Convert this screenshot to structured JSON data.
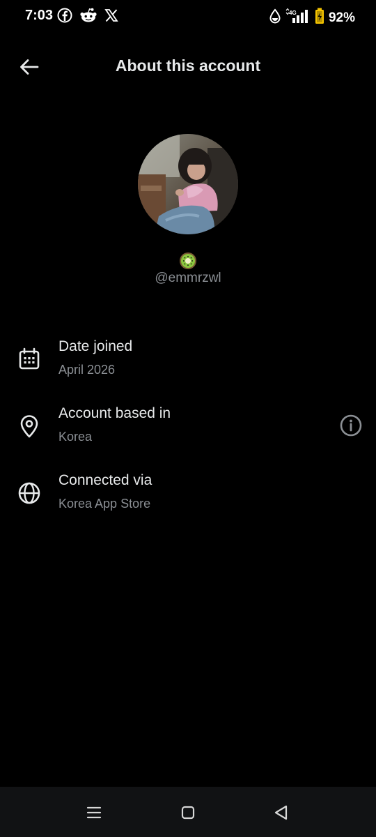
{
  "status_bar": {
    "time": "7:03",
    "network": "4G",
    "battery_percent": "92%",
    "left_icons": [
      "facebook-icon",
      "reddit-icon",
      "x-icon"
    ],
    "right_icons": [
      "data-saver-icon",
      "signal-icon",
      "battery-icon"
    ]
  },
  "header": {
    "title": "About this account",
    "back_icon": "arrow-left-icon"
  },
  "profile": {
    "emoji": "🥝",
    "handle": "@emmrzwl"
  },
  "info": [
    {
      "label": "Date joined",
      "value": "April 2026",
      "icon": "calendar-icon"
    },
    {
      "label": "Account based in",
      "value": "Korea",
      "icon": "location-pin-icon",
      "action_icon": "info-icon"
    },
    {
      "label": "Connected via",
      "value": "Korea App Store",
      "icon": "globe-icon"
    }
  ],
  "nav_bar": {
    "buttons": [
      "recents-icon",
      "home-icon",
      "back-icon"
    ]
  },
  "colors": {
    "background": "#000000",
    "primary_text": "#e7e9ea",
    "secondary_text": "#8b8f94",
    "nav_background": "#111214"
  }
}
